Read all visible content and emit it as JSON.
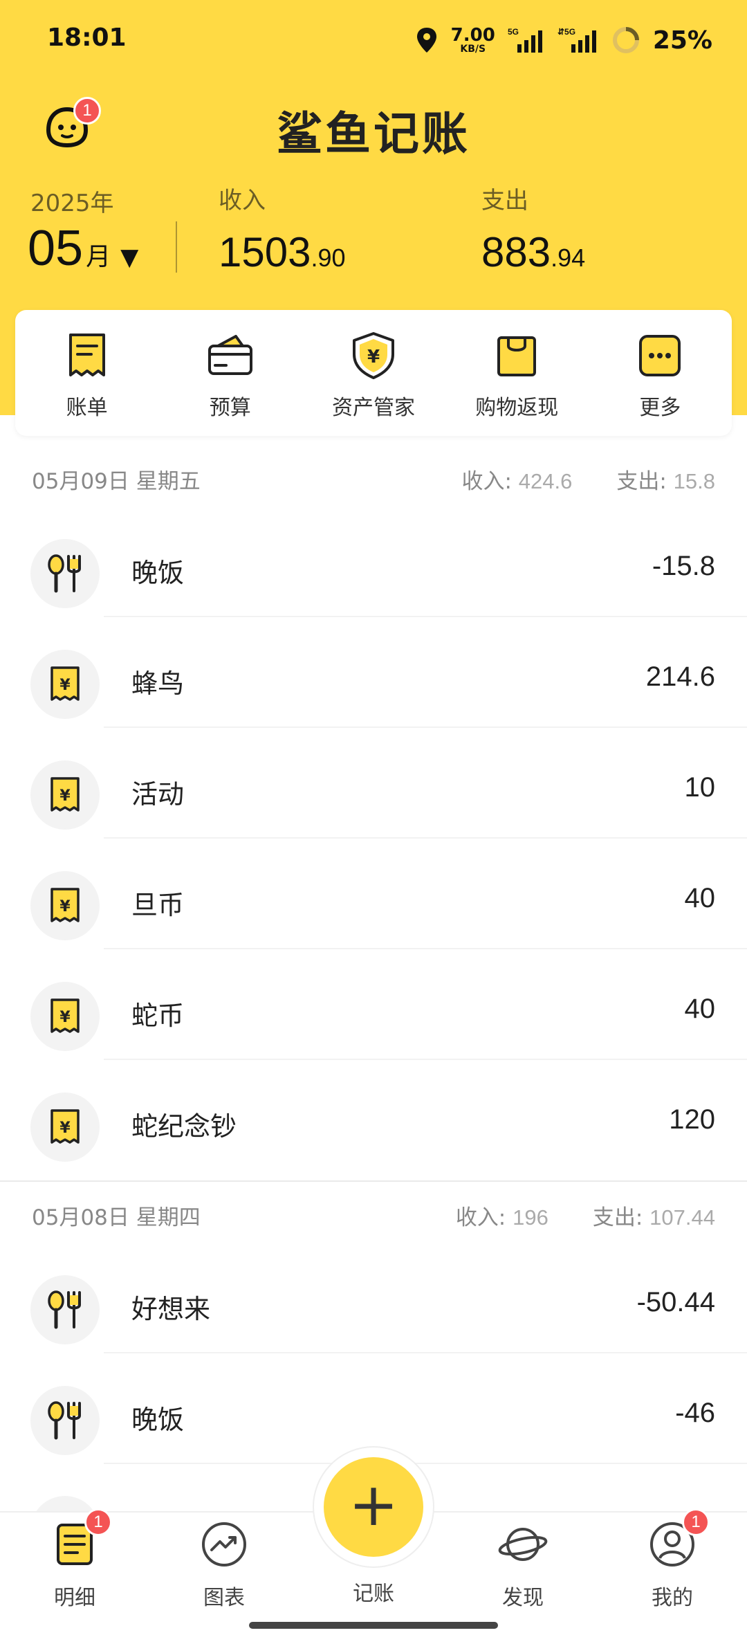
{
  "status_bar": {
    "time": "18:01",
    "net_speed_value": "7.00",
    "net_speed_unit": "KB/S",
    "battery": "25%",
    "icons": [
      "location-icon",
      "signal-5g-icon",
      "signal-5g-icon",
      "battery-ring-icon"
    ]
  },
  "header": {
    "app_title": "鲨鱼记账",
    "avatar_badge": "1",
    "year": "2025年",
    "month_num": "05",
    "month_unit": "月",
    "month_arrow": "▼",
    "income_label": "收入",
    "income_int": "1503",
    "income_dec": ".90",
    "expense_label": "支出",
    "expense_int": "883",
    "expense_dec": ".94"
  },
  "quick_actions": [
    {
      "label": "账单",
      "icon": "bill-icon"
    },
    {
      "label": "预算",
      "icon": "wallet-icon"
    },
    {
      "label": "资产管家",
      "icon": "shield-yen-icon"
    },
    {
      "label": "购物返现",
      "icon": "shopping-bag-icon"
    },
    {
      "label": "更多",
      "icon": "more-icon"
    }
  ],
  "days": [
    {
      "date": "05月09日 星期五",
      "income_label": "收入:",
      "income": "424.6",
      "expense_label": "支出:",
      "expense": "15.8",
      "items": [
        {
          "title": "晚饭",
          "amount": "-15.8",
          "icon": "dining-icon"
        },
        {
          "title": "蜂鸟",
          "amount": "214.6",
          "icon": "receipt-yen-icon"
        },
        {
          "title": "活动",
          "amount": "10",
          "icon": "receipt-yen-icon"
        },
        {
          "title": "旦币",
          "amount": "40",
          "icon": "receipt-yen-icon"
        },
        {
          "title": "蛇币",
          "amount": "40",
          "icon": "receipt-yen-icon"
        },
        {
          "title": "蛇纪念钞",
          "amount": "120",
          "icon": "receipt-yen-icon"
        }
      ]
    },
    {
      "date": "05月08日 星期四",
      "income_label": "收入:",
      "income": "196",
      "expense_label": "支出:",
      "expense": "107.44",
      "items": [
        {
          "title": "好想来",
          "amount": "-50.44",
          "icon": "dining-icon"
        },
        {
          "title": "晚饭",
          "amount": "-46",
          "icon": "dining-icon"
        }
      ]
    }
  ],
  "bottom_nav": {
    "items": [
      {
        "label": "明细",
        "icon": "details-icon",
        "badge": "1"
      },
      {
        "label": "图表",
        "icon": "chart-icon"
      },
      {
        "label": "记账",
        "icon": "add-icon"
      },
      {
        "label": "发现",
        "icon": "planet-icon"
      },
      {
        "label": "我的",
        "icon": "profile-icon",
        "badge": "1"
      }
    ],
    "fab_symbol": "+"
  },
  "colors": {
    "brand_yellow": "#FFDA44",
    "badge_red": "#F45454"
  }
}
